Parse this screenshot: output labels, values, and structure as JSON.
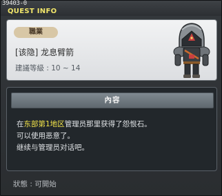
{
  "header": {
    "quest_id": "39403-0",
    "title": "QUEST INFO",
    "close_glyph": "×"
  },
  "quest": {
    "job_badge": "職業",
    "name": "[该隐] 龙息臂箭",
    "level_range": "建議等級 : 10 ~ 14"
  },
  "npc": {
    "icon": "armored-knight-portrait"
  },
  "content": {
    "header": "內容",
    "line1_prefix": "在",
    "line1_highlight": "东部第1地区",
    "line1_suffix": "管理员那里获得了怨恨石。",
    "line2": "可以使用恶意了。",
    "line3": "继续与管理员对话吧。"
  },
  "status": {
    "text": "狀態 : 可開始"
  },
  "colors": {
    "title": "#f2e66a",
    "highlight": "#f0e24a",
    "badge": "#d8c7a6"
  }
}
